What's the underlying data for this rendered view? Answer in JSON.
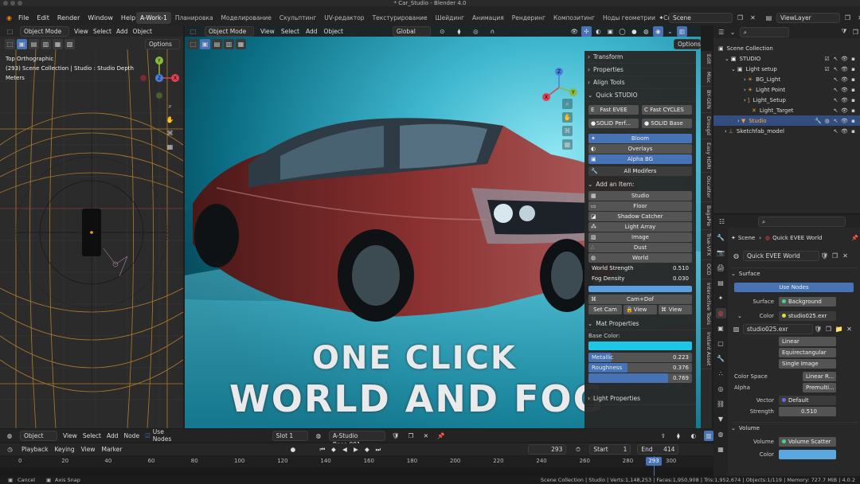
{
  "window": {
    "title": "* Car_Studio - Blender 4.0"
  },
  "menu": [
    "File",
    "Edit",
    "Render",
    "Window",
    "Help"
  ],
  "workspaces": [
    "A-Work-1",
    "Планировка",
    "Моделирование",
    "Скульптинг",
    "UV-редактор",
    "Текстурирование",
    "Шейдинг",
    "Анимация",
    "Рендеринг",
    "Композитинг",
    "Ноды геометрии",
    "Ск"
  ],
  "scene_name": "Scene",
  "view_layer": "ViewLayer",
  "left_viewport": {
    "mode": "Object Mode",
    "menus": [
      "View",
      "Select",
      "Add",
      "Object"
    ],
    "options": "Options",
    "view_name": "Top Orthographic",
    "collection_info": "(293) Scene Collection | Studio : Studio Depth",
    "units": "Meters"
  },
  "main_viewport": {
    "mode": "Object Mode",
    "menus": [
      "View",
      "Select",
      "Add",
      "Object"
    ],
    "transform_orientation": "Global",
    "options": "Options"
  },
  "npanel": {
    "sections": [
      "Transform",
      "Properties",
      "Align Tools",
      "Quick STUDIO"
    ],
    "fast_eevee": "Fast EVEE",
    "fast_cycles": "Fast CYCLES",
    "solid_perf": "SOLID Perf...",
    "solid_base": "SOLID Base",
    "bloom": "Bloom",
    "overlays": "Overlays",
    "alpha_bg": "Alpha BG",
    "all_modifiers": "All Modifers",
    "add_item": "Add an Item:",
    "items": [
      "Studio",
      "Floor",
      "Shadow Catcher",
      "Light Array",
      "Image",
      "Dust",
      "World"
    ],
    "world_strength_label": "World Strength",
    "world_strength": "0.510",
    "fog_density_label": "Fog Density",
    "fog_density": "0.030",
    "cam_dof": "Cam+Dof",
    "set_cam": "Set Cam",
    "view1": "View",
    "view2": "View",
    "mat_properties": "Mat Properties",
    "base_color": "Base Color:",
    "metallic_label": "Metallic",
    "metallic": "0.223",
    "roughness_label": "Roughness",
    "roughness": "0.376",
    "third_value": "0.769",
    "light_properties": "Light Properties"
  },
  "side_tabs": [
    "Edit",
    "Misc",
    "BY-GEN",
    "Drougd",
    "Easy HDRI",
    "Oscatter",
    "BagaPie",
    "True-VFX",
    "OCD",
    "Interactive Tools",
    "Instant Asset"
  ],
  "overlay_text": {
    "line1": "ONE CLICK",
    "line2": "WORLD AND FOG"
  },
  "outliner": {
    "search_placeholder": "",
    "rows": [
      {
        "label": "Scene Collection",
        "indent": 0
      },
      {
        "label": "STUDIO",
        "indent": 1
      },
      {
        "label": "Light setup",
        "indent": 2
      },
      {
        "label": "BG_Light",
        "indent": 3
      },
      {
        "label": "Light Point",
        "indent": 3
      },
      {
        "label": "Light_Setup",
        "indent": 3
      },
      {
        "label": "Light_Target",
        "indent": 3
      },
      {
        "label": "Studio",
        "indent": 2
      },
      {
        "label": "Sketchfab_model",
        "indent": 1
      }
    ]
  },
  "properties": {
    "breadcrumb_scene": "Scene",
    "breadcrumb_world": "Quick EVEE World",
    "world_name": "Quick EVEE World",
    "surface": "Surface",
    "use_nodes": "Use Nodes",
    "surface_label": "Surface",
    "surface_value": "Background",
    "color_label": "Color",
    "color_value": "studio025.exr",
    "image_name": "studio025.exr",
    "interp": "Linear",
    "projection": "Equirectangular",
    "source": "Single Image",
    "color_space_label": "Color Space",
    "color_space": "Linear R...",
    "alpha_label": "Alpha",
    "alpha": "Premulti...",
    "vector_label": "Vector",
    "vector": "Default",
    "strength_label": "Strength",
    "strength": "0.510",
    "volume": "Volume",
    "volume_label": "Volume",
    "volume_value": "Volume Scatter",
    "color2_label": "Color"
  },
  "node_bar": {
    "object": "Object",
    "menus": [
      "View",
      "Select",
      "Add",
      "Node"
    ],
    "use_nodes": "Use Nodes",
    "slot": "Slot 1",
    "material": "A-Studio Base.001"
  },
  "timeline": {
    "playback": "Playback",
    "keying": "Keying",
    "view": "View",
    "marker": "Marker",
    "current_frame": "293",
    "start_label": "Start",
    "start": "1",
    "end_label": "End",
    "end": "414",
    "ticks": [
      "0",
      "20",
      "40",
      "60",
      "80",
      "100",
      "120",
      "140",
      "160",
      "180",
      "200",
      "220",
      "240",
      "260",
      "280",
      "300"
    ],
    "playhead": "293"
  },
  "status": {
    "cancel": "Cancel",
    "axis_snap": "Axis Snap",
    "info": "Scene Collection | Studio | Verts:1,148,253 | Faces:1,950,908 | Tris:1,952,674 | Objects:1/119 | Memory: 727.7 MiB | 4.0.2"
  },
  "colors": {
    "accent": "#4772b3",
    "selected_row": "#334d80",
    "base_color": "#1fc7e6",
    "viewport_bg": "#0b6e84"
  }
}
